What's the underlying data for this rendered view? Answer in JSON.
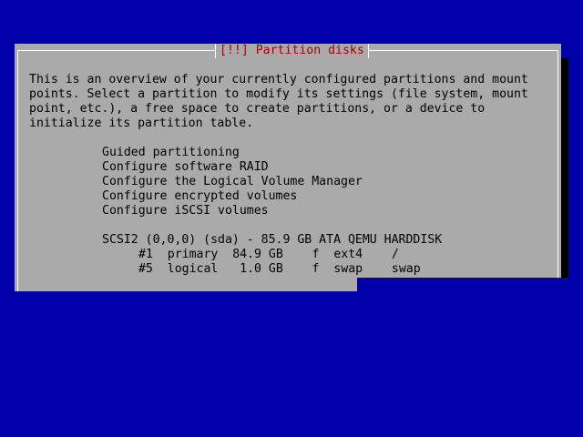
{
  "dialog": {
    "title": "[!!] Partition disks",
    "intro": [
      "This is an overview of your currently configured partitions and mount",
      "points. Select a partition to modify its settings (file system, mount",
      "point, etc.), a free space to create partitions, or a device to",
      "initialize its partition table."
    ],
    "menu": [
      "Guided partitioning",
      "Configure software RAID",
      "Configure the Logical Volume Manager",
      "Configure encrypted volumes",
      "Configure iSCSI volumes"
    ],
    "disk": {
      "header": "SCSI2 (0,0,0) (sda) - 85.9 GB ATA QEMU HARDDISK",
      "partitions": [
        "#1  primary  84.9 GB    f  ext4    /",
        "#5  logical   1.0 GB    f  swap    swap"
      ]
    }
  }
}
